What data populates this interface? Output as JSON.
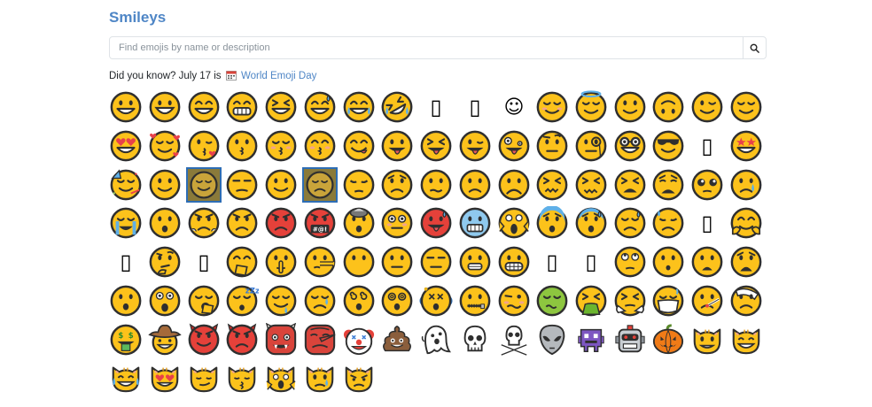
{
  "page": {
    "title": "Smileys"
  },
  "search": {
    "placeholder": "Find emojis by name or description"
  },
  "tip": {
    "text": "Did you know? July 17 is",
    "link_label": "World Emoji Day"
  },
  "colors": {
    "accent": "#4f86c6",
    "face": "#fcc21b",
    "outline": "#2f2f2f"
  },
  "emojis": [
    [
      "grinning",
      "smile-big",
      "grin",
      "grimace",
      "squint",
      "sweat-smile",
      "joy",
      "rofl",
      "missing",
      "missing",
      "relaxed",
      "blush",
      "halo",
      "slight-smile",
      "upside-down",
      "wink",
      "relieved"
    ],
    [
      "heart-eyes",
      "hearts",
      "kiss-heart",
      "kissing",
      "kiss-closed",
      "kiss-smile",
      "yum",
      "tongue",
      "squint-tongue",
      "wink-tongue",
      "zany",
      "raised-brow",
      "monocle",
      "nerd",
      "sunglasses",
      "missing",
      "star-struck"
    ],
    [
      "partying",
      "smile-plain",
      "smile-box",
      "unamused",
      "smile-plain",
      "pensive-box",
      "pensive",
      "worried",
      "confused",
      "slight-frown",
      "frown",
      "persevere",
      "confounded",
      "tired",
      "weary",
      "pleading",
      "cry"
    ],
    [
      "sob",
      "triumph-open",
      "steam",
      "angry",
      "rage",
      "cursing",
      "mind-blown",
      "flushed",
      "hot",
      "cold",
      "scream",
      "fearful",
      "cold-sweat",
      "disappointed-relieved",
      "downcast-sweat",
      "missing",
      "hug"
    ],
    [
      "missing",
      "thinking",
      "missing",
      "hand-mouth",
      "shush",
      "lying",
      "no-mouth",
      "neutral",
      "expressionless",
      "grimace-line",
      "grimacing",
      "missing",
      "missing",
      "eyeroll",
      "hushed",
      "frowning-open",
      "anguished"
    ],
    [
      "open-mouth",
      "astonished",
      "yawn",
      "sleeping",
      "drool",
      "sleepy",
      "dizzy",
      "dizzy-eyes",
      "spiral-box",
      "zipper",
      "woozy",
      "nauseated",
      "vomit",
      "sneeze",
      "mask",
      "thermometer",
      "bandage"
    ],
    [
      "money",
      "cowboy",
      "smiling-devil",
      "angry-devil",
      "ogre",
      "goblin",
      "clown",
      "poop",
      "ghost",
      "skull",
      "crossbones",
      "alien",
      "space-invader",
      "robot",
      "pumpkin",
      "cat-smile",
      "cat-grin"
    ],
    [
      "cat-joy",
      "cat-heart",
      "cat-smirk",
      "cat-kiss",
      "cat-scream",
      "cat-cry",
      "cat-pout"
    ]
  ]
}
